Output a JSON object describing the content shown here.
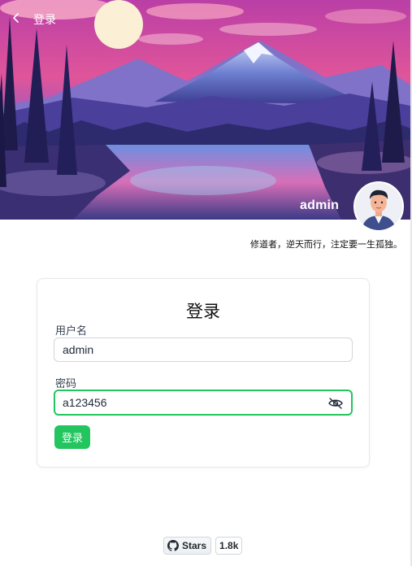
{
  "nav": {
    "back_icon": "chevron-left-icon",
    "title": "登录"
  },
  "profile": {
    "username": "admin",
    "motto": "修道者，逆天而行，注定要一生孤独。",
    "avatar_icon": "cartoon-avatar"
  },
  "login_form": {
    "title": "登录",
    "username_label": "用户名",
    "username_value": "admin",
    "password_label": "密码",
    "password_value": "a123456",
    "password_toggle_icon": "eye-off-icon",
    "submit_label": "登录"
  },
  "github": {
    "stars_label": "Stars",
    "stars_count": "1.8k",
    "icon": "github-icon"
  },
  "colors": {
    "accent": "#22c55e",
    "text": "#1f2937",
    "border": "#e5e7eb"
  }
}
